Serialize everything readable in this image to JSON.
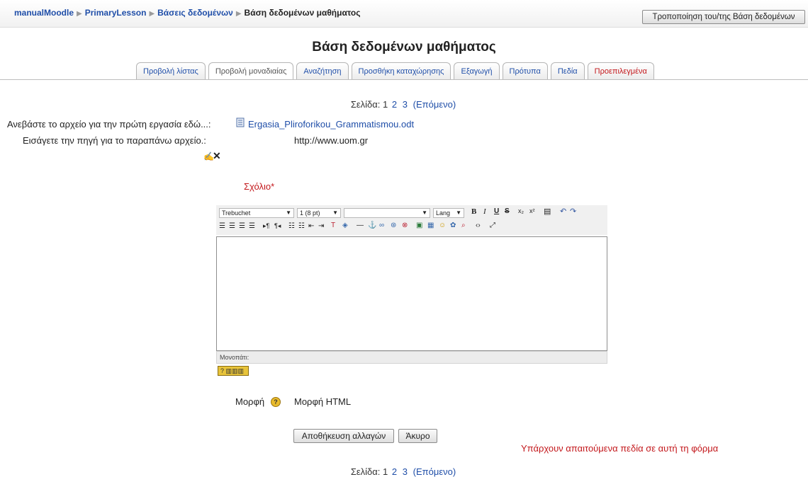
{
  "navbar": {
    "crumbs": [
      "manualMoodle",
      "PrimaryLesson",
      "Βάσεις δεδομένων",
      "Βάση δεδομένων μαθήματος"
    ],
    "edit_button": "Τροποποίηση του/της Βάση δεδομένων"
  },
  "title": "Βάση δεδομένων μαθήματος",
  "tabs": [
    "Προβολή λίστας",
    "Προβολή μοναδιαίας",
    "Αναζήτηση",
    "Προσθήκη καταχώρησης",
    "Εξαγωγή",
    "Πρότυπα",
    "Πεδία",
    "Προεπιλεγμένα"
  ],
  "pager": {
    "label": "Σελίδα:",
    "current": "1",
    "pages": [
      "2",
      "3"
    ],
    "next": "(Επόμενο)"
  },
  "fields": {
    "upload_label": "Ανεβάστε το αρχείο για την πρώτη εργασία εδώ...:",
    "upload_file": "Ergasia_Pliroforikou_Grammatismou.odt",
    "source_label": "Εισάγετε την πηγή για το παραπάνω αρχείο.:",
    "source_value": "http://www.uom.gr",
    "comment_label": "Σχόλιο*"
  },
  "editor": {
    "font": "Trebuchet",
    "size": "1 (8 pt)",
    "format": "",
    "lang": "Lang",
    "path_label": "Μονοπάτι:",
    "help_badge": "?"
  },
  "format": {
    "label": "Μορφή",
    "value": "Μορφή HTML"
  },
  "buttons": {
    "save": "Αποθήκευση αλλαγών",
    "cancel": "Άκυρο"
  },
  "required_note": "Υπάρχουν απαιτούμενα πεδία σε αυτή τη φόρμα",
  "colors": {
    "link": "#1f4ea8",
    "required": "#c3171b"
  }
}
